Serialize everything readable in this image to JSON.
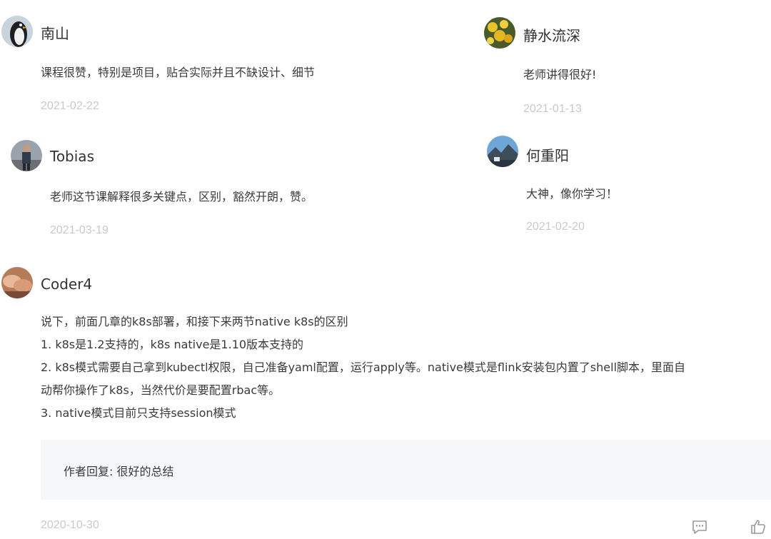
{
  "comments": [
    {
      "username": "南山",
      "text": "课程很赞，特别是项目，贴合实际并且不缺设计、细节",
      "date": "2021-02-22",
      "avatar": "penguin-avatar-icon"
    },
    {
      "username": "静水流深",
      "text": "老师讲得很好!",
      "date": "2021-01-13",
      "avatar": "yellow-flowers-avatar-icon"
    },
    {
      "username": "Tobias",
      "text": "老师这节课解释很多关键点，区别，豁然开朗，赞。",
      "date": "2021-03-19",
      "avatar": "person-photo-avatar-icon"
    },
    {
      "username": "何重阳",
      "text": "大神，像你学习！",
      "date": "2021-02-20",
      "avatar": "mountain-landscape-avatar-icon"
    },
    {
      "username": "Coder4",
      "lines": [
        "说下，前面几章的k8s部署，和接下来两节native k8s的区别",
        "1. k8s是1.2支持的，k8s native是1.10版本支持的",
        "2. k8s模式需要自己拿到kubectl权限，自己准备yaml配置，运行apply等。native模式是flink安装包内置了shell脚本，里面自",
        "动帮你操作了k8s，当然代价是要配置rbac等。",
        "3. native模式目前只支持session模式"
      ],
      "reply": "作者回复: 很好的总结",
      "date": "2020-10-30",
      "avatar": "hands-photo-avatar-icon"
    }
  ],
  "actions": {
    "comment_icon": "comment-icon",
    "like_icon": "thumbs-up-icon"
  },
  "colors": {
    "date": "#c9c9c9",
    "reply_bg": "#f6f7f9",
    "text": "#3a3a3a"
  }
}
